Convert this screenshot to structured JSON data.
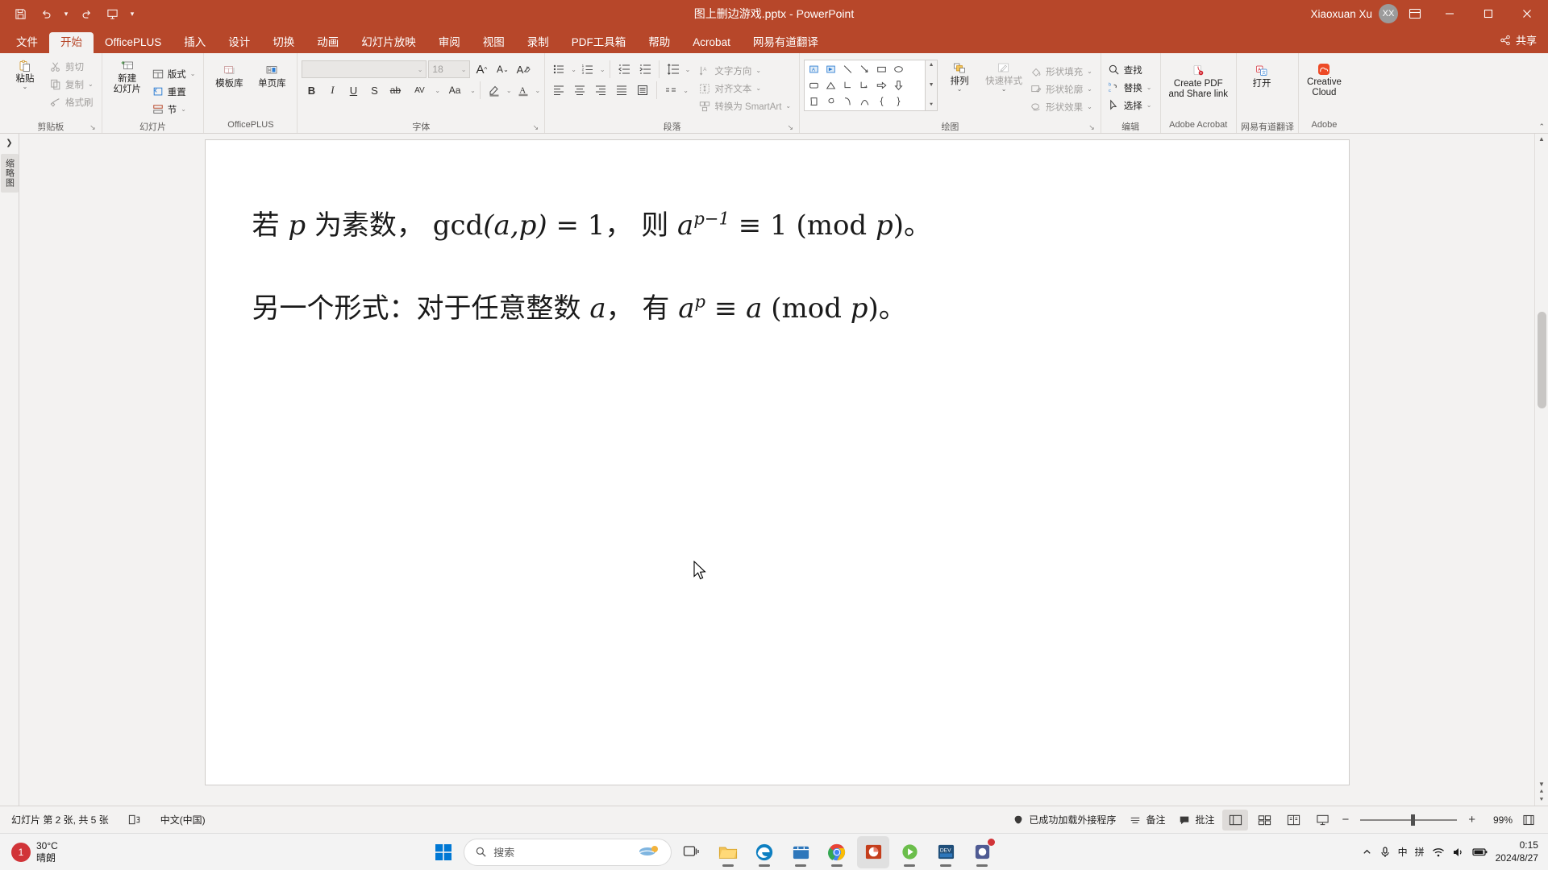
{
  "titlebar": {
    "quick_access": [
      {
        "name": "save-icon",
        "label": "保存"
      },
      {
        "name": "undo-icon",
        "label": "撤消"
      },
      {
        "name": "redo-icon",
        "label": "恢复"
      },
      {
        "name": "start-slideshow-icon",
        "label": "从头开始"
      },
      {
        "name": "customize-qat-icon",
        "label": "自定义快速访问工具栏"
      }
    ],
    "document_title": "图上删边游戏.pptx",
    "app_name": "PowerPoint",
    "title_separator": "-",
    "user_name": "Xiaoxuan Xu",
    "user_initials": "XX",
    "ribbon_display_label": "功能区显示选项",
    "minimize_label": "最小化",
    "maximize_label": "最大化",
    "close_label": "关闭"
  },
  "tabs": [
    {
      "label": "文件",
      "active": false
    },
    {
      "label": "开始",
      "active": true
    },
    {
      "label": "OfficePLUS",
      "active": false
    },
    {
      "label": "插入",
      "active": false
    },
    {
      "label": "设计",
      "active": false
    },
    {
      "label": "切换",
      "active": false
    },
    {
      "label": "动画",
      "active": false
    },
    {
      "label": "幻灯片放映",
      "active": false
    },
    {
      "label": "审阅",
      "active": false
    },
    {
      "label": "视图",
      "active": false
    },
    {
      "label": "录制",
      "active": false
    },
    {
      "label": "PDF工具箱",
      "active": false
    },
    {
      "label": "帮助",
      "active": false
    },
    {
      "label": "Acrobat",
      "active": false
    },
    {
      "label": "网易有道翻译",
      "active": false
    }
  ],
  "share_label": "共享",
  "ribbon": {
    "clipboard": {
      "group_label": "剪贴板",
      "paste_label": "粘贴",
      "cut_label": "剪切",
      "copy_label": "复制",
      "format_painter_label": "格式刷"
    },
    "slides": {
      "group_label": "幻灯片",
      "new_slide_label_1": "新建",
      "new_slide_label_2": "幻灯片",
      "layout_label": "版式",
      "reset_label": "重置",
      "section_label": "节"
    },
    "officeplus": {
      "group_label": "OfficePLUS",
      "template_library_label": "模板库",
      "page_library_label": "单页库"
    },
    "font": {
      "group_label": "字体",
      "font_name_value": "",
      "font_size_value": "18",
      "bold_label": "B",
      "italic_label": "I",
      "underline_label": "U",
      "shadow_label": "S",
      "strikethrough_label": "ab",
      "char_spacing_label": "AV",
      "change_case_label": "Aa",
      "increase_size_label": "A",
      "decrease_size_label": "A",
      "clear_format_label": "A"
    },
    "paragraph": {
      "group_label": "段落",
      "text_direction_label": "文字方向",
      "align_text_label": "对齐文本",
      "smartart_label": "转换为 SmartArt"
    },
    "drawing": {
      "group_label": "绘图",
      "arrange_label": "排列",
      "quick_styles_label": "快速样式",
      "shape_fill_label": "形状填充",
      "shape_outline_label": "形状轮廓",
      "shape_effects_label": "形状效果"
    },
    "editing": {
      "group_label": "编辑",
      "find_label": "查找",
      "replace_label": "替换",
      "select_label": "选择"
    },
    "acrobat": {
      "group_label": "Adobe Acrobat",
      "create_pdf_label_1": "Create PDF",
      "create_pdf_label_2": "and Share link"
    },
    "youdao": {
      "group_label": "网易有道翻译",
      "open_label": "打开"
    },
    "adobe": {
      "group_label": "Adobe",
      "creative_cloud_label_1": "Creative",
      "creative_cloud_label_2": "Cloud"
    }
  },
  "leftrail": {
    "thumbnail_pane_label": "缩略图"
  },
  "slide": {
    "line1": {
      "prefix": "若",
      "var_p": "p",
      "text_a": "为素数，",
      "gcd": "gcd",
      "gcd_args": "(a,p)",
      "eq1": "= 1",
      "comma": "，",
      "then": "则",
      "base_a": "a",
      "exponent": "p−1",
      "equiv": "≡ 1",
      "mod_open": "(",
      "mod_text": "mod",
      "mod_var": "p",
      "mod_close": ")",
      "period": "。"
    },
    "line2": {
      "prefix": "另一个形式：对于任意整数",
      "var_a": "a",
      "comma": "，",
      "have": "有",
      "base_a": "a",
      "exponent": "p",
      "equiv": "≡",
      "rhs": "a",
      "mod_open": "(",
      "mod_text": "mod",
      "mod_var": "p",
      "mod_close": ")",
      "period": "。"
    }
  },
  "statusbar": {
    "slide_counter": "幻灯片 第 2 张, 共 5 张",
    "accessibility_label": "辅助功能",
    "language": "中文(中国)",
    "addin_status": "已成功加载外接程序",
    "notes_label": "备注",
    "comments_label": "批注",
    "view_normal_label": "普通视图",
    "view_sorter_label": "幻灯片浏览",
    "view_reading_label": "阅读视图",
    "view_show_label": "幻灯片放映",
    "zoom_out_label": "缩小",
    "zoom_in_label": "放大",
    "zoom_value": "99%",
    "fit_label": "使幻灯片适应当前窗口"
  },
  "taskbar": {
    "weather_temp": "30°C",
    "weather_desc": "晴朗",
    "weather_badge": "1",
    "start_label": "开始",
    "search_placeholder": "搜索",
    "task_view_label": "任务视图",
    "apps": [
      {
        "name": "file-explorer-icon",
        "label": "文件资源管理器"
      },
      {
        "name": "edge-icon",
        "label": "Microsoft Edge"
      },
      {
        "name": "store-icon",
        "label": "Microsoft Store"
      },
      {
        "name": "chrome-icon",
        "label": "Google Chrome"
      },
      {
        "name": "powerpoint-icon",
        "label": "PowerPoint"
      },
      {
        "name": "media-icon",
        "label": "媒体应用"
      },
      {
        "name": "devcpp-icon",
        "label": "Dev-C++"
      },
      {
        "name": "notification-app-icon",
        "label": "应用"
      }
    ],
    "tray": {
      "show_hidden_label": "显示隐藏的图标",
      "mic_label": "麦克风",
      "ime_label": "中",
      "pinyin_label": "拼",
      "network_label": "网络",
      "volume_label": "音量",
      "battery_label": "电池",
      "time": "0:15",
      "date": "2024/8/27"
    }
  },
  "colors": {
    "accent": "#B7472A",
    "ribbon_bg": "#F3F2F1",
    "workspace_bg": "#F3F2F1",
    "taskbar_bg": "#F3F3F3"
  }
}
